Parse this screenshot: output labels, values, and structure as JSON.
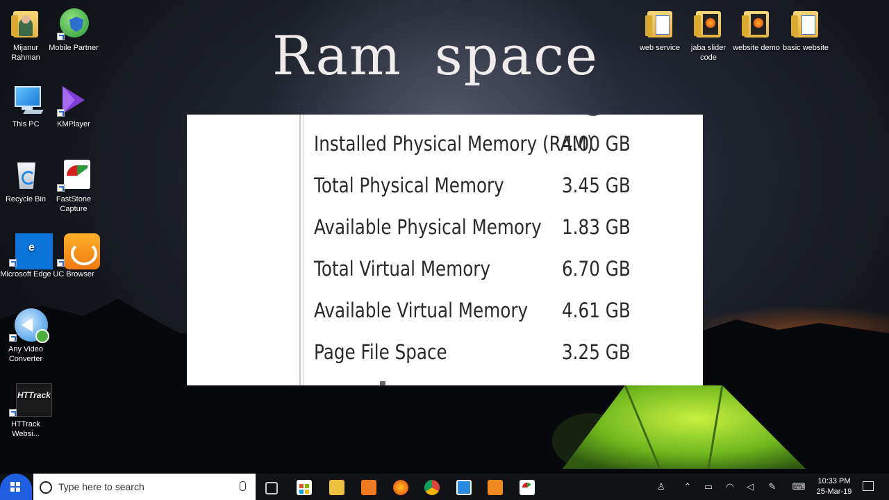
{
  "headline": "Ram space",
  "desktop_icons_left": [
    {
      "label": "Mijanur Rahman"
    },
    {
      "label": "Mobile Partner"
    },
    {
      "label": "This PC"
    },
    {
      "label": "KMPlayer"
    },
    {
      "label": "Recycle Bin"
    },
    {
      "label": "FastStone Capture"
    },
    {
      "label": "Microsoft Edge"
    },
    {
      "label": "UC Browser"
    },
    {
      "label": "Any Video Converter"
    },
    {
      "label": "HTTrack Websi..."
    }
  ],
  "desktop_icons_right": [
    {
      "label": "web service"
    },
    {
      "label": "jaba slider code"
    },
    {
      "label": "website demo"
    },
    {
      "label": "basic website"
    }
  ],
  "httrack_logo_text": "HTTrack",
  "memory_info": [
    {
      "label": "Installed Physical Memory (RAM)",
      "value": "4.00 GB"
    },
    {
      "label": "Total Physical Memory",
      "value": "3.45 GB"
    },
    {
      "label": "Available Physical Memory",
      "value": "1.83 GB"
    },
    {
      "label": "Total Virtual Memory",
      "value": "6.70 GB"
    },
    {
      "label": "Available Virtual Memory",
      "value": "4.61 GB"
    },
    {
      "label": "Page File Space",
      "value": "3.25 GB"
    }
  ],
  "taskbar": {
    "search_placeholder": "Type here to search",
    "clock_time": "10:33 PM",
    "clock_date": "25-Mar-19"
  },
  "colors": {
    "start_button": "#1f5ee0",
    "taskbar": "#101216",
    "tent": "#8fd12a"
  }
}
